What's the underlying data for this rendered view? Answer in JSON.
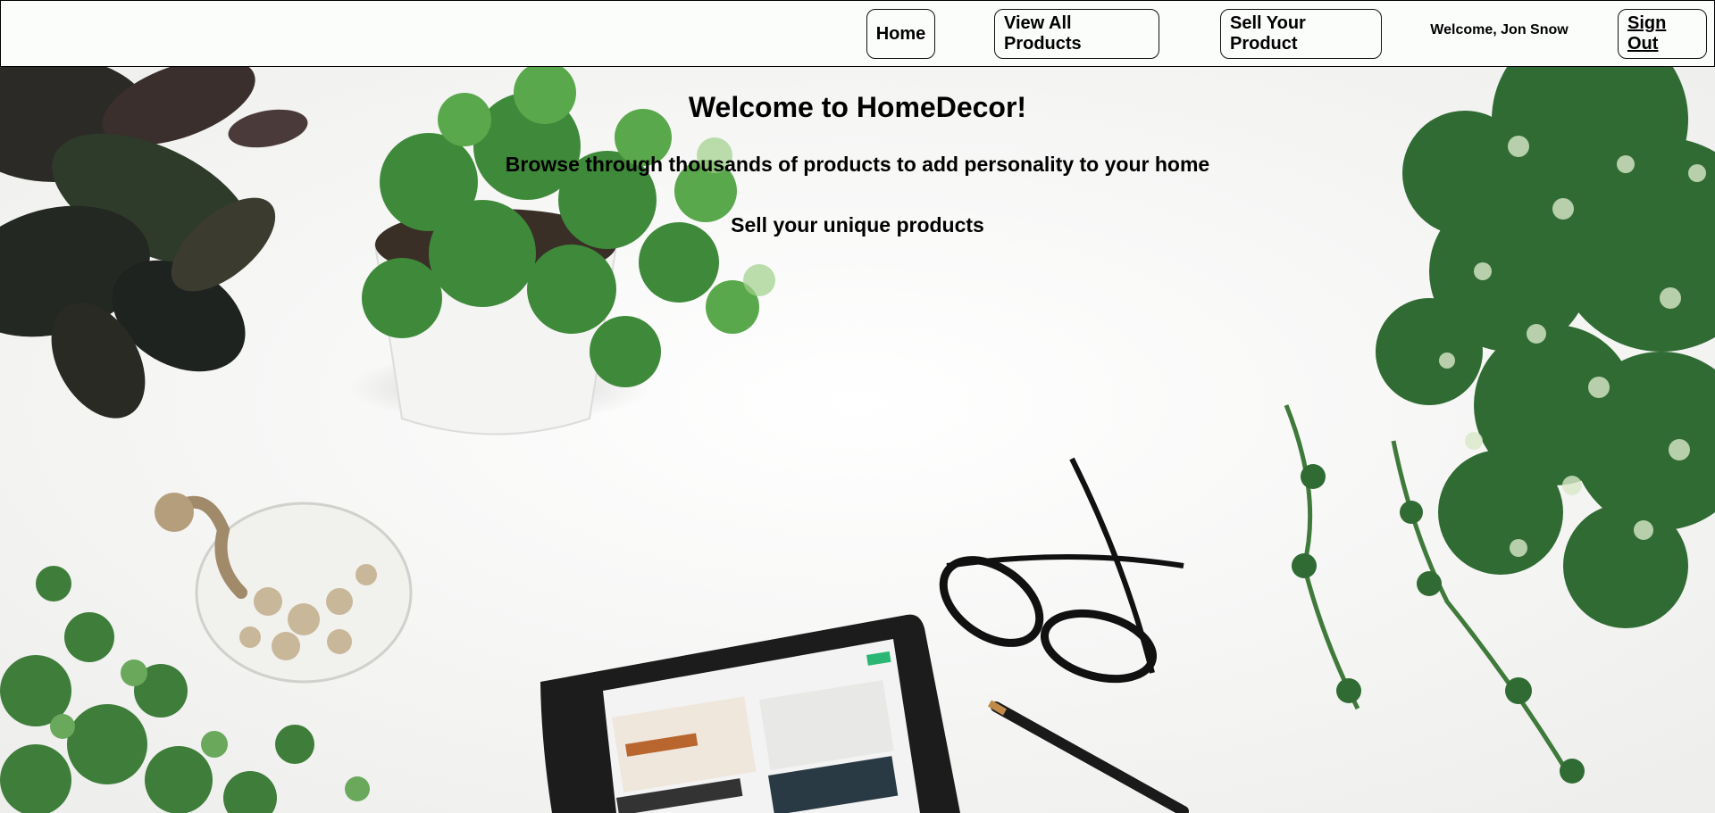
{
  "navbar": {
    "home_label": "Home",
    "view_all_label": "View All Products",
    "sell_label": "Sell Your Product",
    "welcome_text": "Welcome, Jon Snow",
    "sign_out_label": "Sign Out"
  },
  "hero": {
    "title": "Welcome to HomeDecor!",
    "subtitle": "Browse through thousands of products to add personality to your home",
    "subtitle2": "Sell your unique products"
  },
  "colors": {
    "navbar_bg": "#fbfdfb",
    "border": "#000000",
    "text": "#000000",
    "background": "#f6f6f4"
  },
  "icons": {
    "background_scene": "plants-glasses-tablet-photo"
  }
}
